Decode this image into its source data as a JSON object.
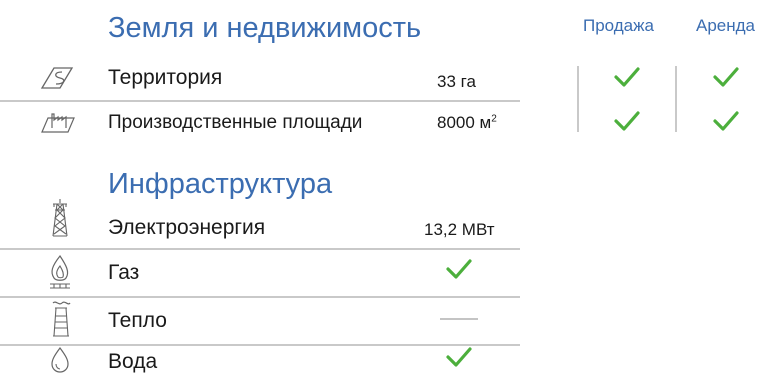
{
  "land": {
    "title": "Земля и недвижимость",
    "col_sale": "Продажа",
    "col_rent": "Аренда",
    "rows": [
      {
        "icon": "territory-icon",
        "label": "Территория",
        "value": "33 га",
        "sale": true,
        "rent": true
      },
      {
        "icon": "factory-icon",
        "label": "Производственные площади",
        "value": "8000 м",
        "unit_sup": "2",
        "sale": true,
        "rent": true
      }
    ]
  },
  "infra": {
    "title": "Инфраструктура",
    "rows": [
      {
        "icon": "power-tower-icon",
        "label": "Электроэнергия",
        "value": "13,2 МВт"
      },
      {
        "icon": "gas-flame-icon",
        "label": "Газ",
        "status": "check"
      },
      {
        "icon": "heat-radiator-icon",
        "label": "Тепло",
        "status": "none"
      },
      {
        "icon": "water-drop-icon",
        "label": "Вода",
        "status": "check"
      }
    ]
  },
  "colors": {
    "accent": "#3b6db1",
    "check": "#4caf3c",
    "divider": "#c9c9c9"
  }
}
